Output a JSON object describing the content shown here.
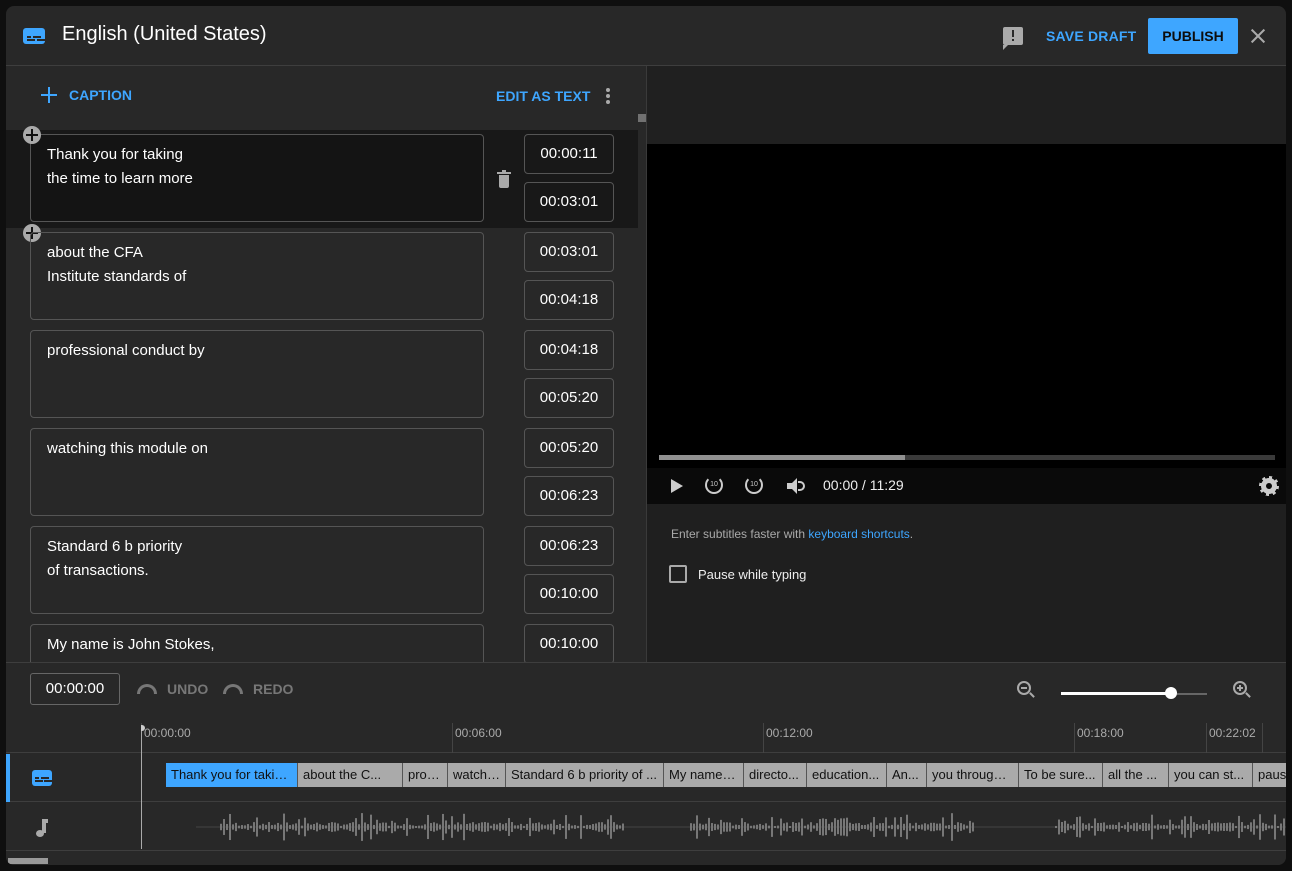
{
  "header": {
    "title": "English (United States)",
    "save_draft": "SAVE DRAFT",
    "publish": "PUBLISH"
  },
  "caption_panel": {
    "add_caption": "CAPTION",
    "edit_as_text": "EDIT AS TEXT",
    "captions": [
      {
        "text": "Thank you for taking\nthe time to learn more",
        "start": "00:00:11",
        "end": "00:03:01",
        "active": true
      },
      {
        "text": "about the CFA\nInstitute standards of",
        "start": "00:03:01",
        "end": "00:04:18"
      },
      {
        "text": "professional conduct by",
        "start": "00:04:18",
        "end": "00:05:20"
      },
      {
        "text": "watching this module on",
        "start": "00:05:20",
        "end": "00:06:23"
      },
      {
        "text": "Standard 6 b priority\nof transactions.",
        "start": "00:06:23",
        "end": "00:10:00"
      },
      {
        "text": "My name is John Stokes,",
        "start": "00:10:00",
        "end": ""
      }
    ]
  },
  "player": {
    "time_readout": "00:00 / 11:29",
    "progress_fraction": 0.4,
    "rewind_label": "10",
    "forward_label": "10",
    "hint_prefix": "Enter subtitles faster with ",
    "hint_link": "keyboard shortcuts",
    "hint_suffix": ".",
    "pause_while_typing": "Pause while typing",
    "pause_while_typing_checked": false
  },
  "timeline": {
    "current_time": "00:00:00",
    "undo": "UNDO",
    "redo": "REDO",
    "zoom_level_fraction": 0.75,
    "ruler_ticks": [
      "00:00:00",
      "00:06:00",
      "00:12:00",
      "00:18:00",
      "00:22:02"
    ],
    "caption_chips": [
      {
        "label": "Thank you for takin...",
        "selected": true
      },
      {
        "label": "about the C..."
      },
      {
        "label": "profe..."
      },
      {
        "label": "watchi..."
      },
      {
        "label": "Standard 6 b priority of ..."
      },
      {
        "label": "My name i..."
      },
      {
        "label": "directo..."
      },
      {
        "label": "education..."
      },
      {
        "label": "An..."
      },
      {
        "label": "you through ..."
      },
      {
        "label": "To be sure..."
      },
      {
        "label": "all the ..."
      },
      {
        "label": "you can st..."
      },
      {
        "label": "paus"
      }
    ]
  },
  "colors": {
    "accent": "#3ea6ff",
    "background": "#282828",
    "video": "#000000"
  }
}
